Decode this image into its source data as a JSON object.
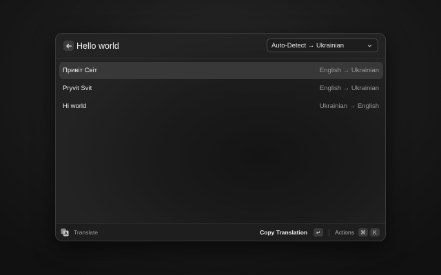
{
  "search": {
    "query": "Hello world"
  },
  "language_selector": {
    "selected": "Auto-Detect → Ukrainian"
  },
  "results": [
    {
      "title": "Привіт Світ",
      "accessory": "English → Ukrainian",
      "selected": true
    },
    {
      "title": "Pryvit Svit",
      "accessory": "English → Ukrainian",
      "selected": false
    },
    {
      "title": "Hi world",
      "accessory": "Ukrainian → English",
      "selected": false
    }
  ],
  "footer": {
    "app_name": "Translate",
    "primary_action": "Copy Translation",
    "primary_shortcut": "↵",
    "actions_label": "Actions",
    "actions_shortcut": [
      "⌘",
      "K"
    ]
  }
}
